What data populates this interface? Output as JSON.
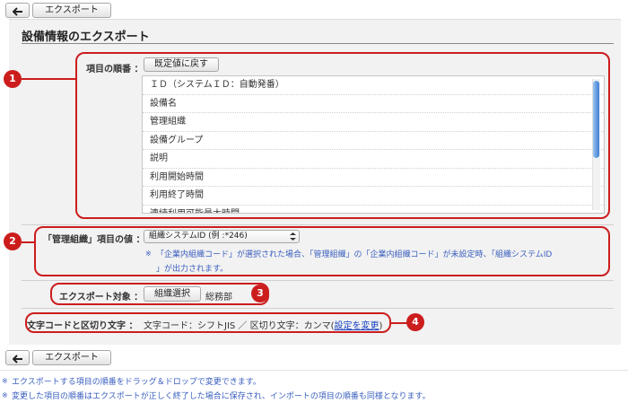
{
  "toolbar": {
    "back_icon": "back-arrow-icon",
    "export_label": "エクスポート"
  },
  "page": {
    "title": "設備情報のエクスポート"
  },
  "order_row": {
    "label": "項目の順番 ：",
    "reset_label": "既定値に戻す",
    "items": [
      "ＩＤ（システムＩＤ：自動発番）",
      "設備名",
      "管理組織",
      "設備グループ",
      "説明",
      "利用開始時間",
      "利用終了時間",
      "連続利用可能最大時間"
    ]
  },
  "org_row": {
    "label": "「管理組織」項目の値 ：",
    "select_value": "組織システムID (例 :*246)",
    "note_mark": "※",
    "note_line1": "「企業内組織コード」が選択された場合、「管理組織」の「企業内組織コード」が未設定時、「組織システムID",
    "note_line2": "」が出力されます。"
  },
  "target_row": {
    "label": "エクスポート対象 ：",
    "button_label": "組織選択",
    "selected_value": "総務部"
  },
  "encoding_row": {
    "label": "文字コードと区切り文字 ：",
    "value_text": "文字コード：シフトJIS ／ 区切り文字：カンマ",
    "paren_open": "(",
    "change_link": "設定を変更",
    "paren_close": ")"
  },
  "annotations": [
    "1",
    "2",
    "3",
    "4"
  ],
  "footer_notes": {
    "mark": "※",
    "note1": "エクスポートする項目の順番をドラッグ＆ドロップで変更できます。",
    "note2": "変更した項目の順番はエクスポートが正しく終了した場合に保存され、インポートの項目の順番も同様となります。"
  },
  "colors": {
    "annotation_red": "#cc1d1d",
    "note_blue": "#3a5fbf",
    "link_blue": "#1a44c4",
    "scroll_blue": "#3d7fd5"
  }
}
